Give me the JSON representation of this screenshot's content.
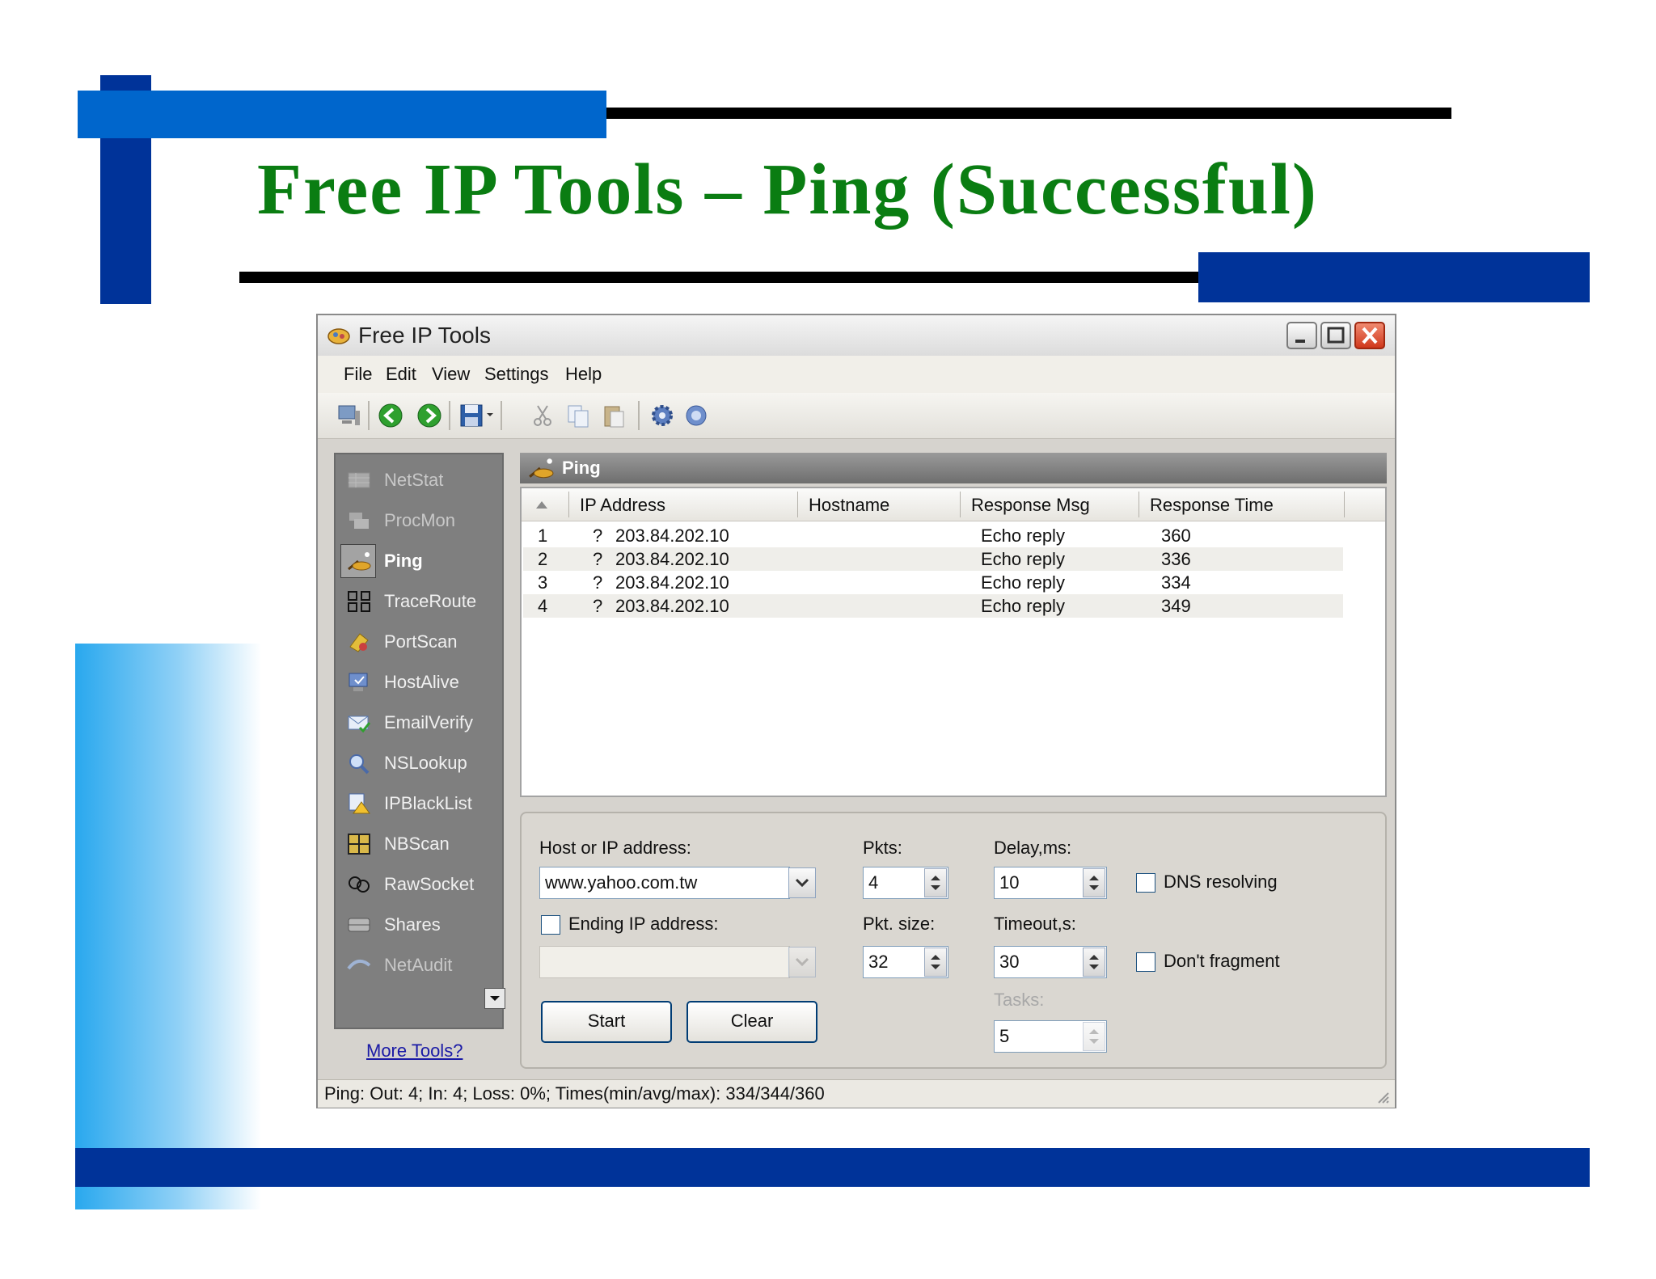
{
  "slide": {
    "title": "Free IP Tools – Ping (Successful)"
  },
  "window": {
    "title": "Free IP Tools",
    "menu": [
      "File",
      "Edit",
      "View",
      "Settings",
      "Help"
    ]
  },
  "sidebar": {
    "items": [
      {
        "label": "NetStat",
        "icon": "netstat-icon",
        "state": "dim"
      },
      {
        "label": "ProcMon",
        "icon": "procmon-icon",
        "state": "dim"
      },
      {
        "label": "Ping",
        "icon": "ping-icon",
        "state": "active"
      },
      {
        "label": "TraceRoute",
        "icon": "traceroute-icon",
        "state": "normal"
      },
      {
        "label": "PortScan",
        "icon": "portscan-icon",
        "state": "normal"
      },
      {
        "label": "HostAlive",
        "icon": "hostalive-icon",
        "state": "normal"
      },
      {
        "label": "EmailVerify",
        "icon": "emailverify-icon",
        "state": "normal"
      },
      {
        "label": "NSLookup",
        "icon": "nslookup-icon",
        "state": "normal"
      },
      {
        "label": "IPBlackList",
        "icon": "ipblacklist-icon",
        "state": "normal"
      },
      {
        "label": "NBScan",
        "icon": "nbscan-icon",
        "state": "normal"
      },
      {
        "label": "RawSocket",
        "icon": "rawsocket-icon",
        "state": "normal"
      },
      {
        "label": "Shares",
        "icon": "shares-icon",
        "state": "normal"
      },
      {
        "label": "NetAudit",
        "icon": "netaudit-icon",
        "state": "dim"
      }
    ],
    "more_tools": "More Tools?"
  },
  "panel": {
    "title": "Ping",
    "columns": [
      "IP Address",
      "Hostname",
      "Response Msg",
      "Response Time"
    ],
    "rows": [
      {
        "num": "1",
        "flag": "?",
        "ip": "203.84.202.10",
        "hostname": "",
        "msg": "Echo reply",
        "time": "360"
      },
      {
        "num": "2",
        "flag": "?",
        "ip": "203.84.202.10",
        "hostname": "",
        "msg": "Echo reply",
        "time": "336"
      },
      {
        "num": "3",
        "flag": "?",
        "ip": "203.84.202.10",
        "hostname": "",
        "msg": "Echo reply",
        "time": "334"
      },
      {
        "num": "4",
        "flag": "?",
        "ip": "203.84.202.10",
        "hostname": "",
        "msg": "Echo reply",
        "time": "349"
      }
    ]
  },
  "options": {
    "host_label": "Host or IP address:",
    "host_value": "www.yahoo.com.tw",
    "ending_ip_label": "Ending IP address:",
    "ending_ip_value": "",
    "ending_ip_checked": false,
    "pkts_label": "Pkts:",
    "pkts_value": "4",
    "pkt_size_label": "Pkt. size:",
    "pkt_size_value": "32",
    "delay_label": "Delay,ms:",
    "delay_value": "10",
    "timeout_label": "Timeout,s:",
    "timeout_value": "30",
    "tasks_label": "Tasks:",
    "tasks_value": "5",
    "dns_label": "DNS resolving",
    "dns_checked": false,
    "dont_fragment_label": "Don't fragment",
    "dont_fragment_checked": false,
    "start_label": "Start",
    "clear_label": "Clear"
  },
  "status": {
    "text": "Ping: Out: 4; In: 4; Loss: 0%; Times(min/avg/max): 334/344/360"
  },
  "colors": {
    "title_green": "#0a7d12",
    "deco_blue": "#003399",
    "deco_light_blue": "#0066cc",
    "sidebar_gray": "#7f7f7f",
    "close_red": "#d0381c"
  }
}
